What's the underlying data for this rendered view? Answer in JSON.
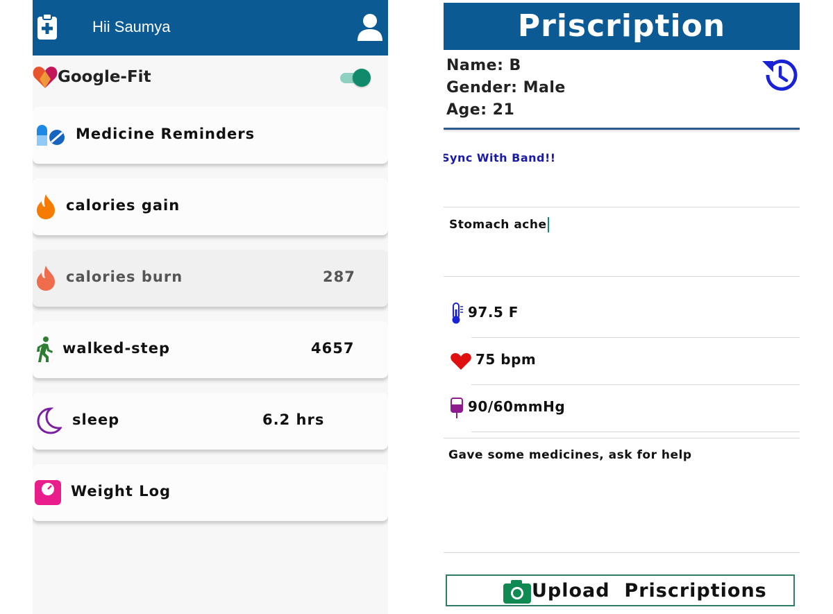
{
  "left_app": {
    "greeting": "Hii Saumya",
    "google_fit": {
      "label": "Google-Fit",
      "enabled": true
    },
    "items": [
      {
        "label": "Medicine Reminders",
        "value": ""
      },
      {
        "label": "calories gain",
        "value": ""
      },
      {
        "label": "calories burn",
        "value": "287"
      },
      {
        "label": "walked-step",
        "value": "4657"
      },
      {
        "label": "sleep",
        "value": "6.2 hrs"
      },
      {
        "label": "Weight Log",
        "value": ""
      }
    ]
  },
  "right_app": {
    "title": "Priscription",
    "patient": {
      "name": "Name: B",
      "gender": "Gender: Male",
      "age": "Age: 21"
    },
    "sync_label": "Sync With Band!!",
    "symptom_text": "Stomach ache",
    "vitals": {
      "temperature": "97.5 F",
      "heart_rate": "75 bpm",
      "blood_pressure": "90/60mmHg"
    },
    "notes": "Gave some medicines, ask for help",
    "upload_label": "Upload  Priscriptions"
  },
  "colors": {
    "header_blue": "#0b5a93",
    "toggle_green": "#0f8a6a",
    "sync_blue": "#1a1aa8"
  }
}
